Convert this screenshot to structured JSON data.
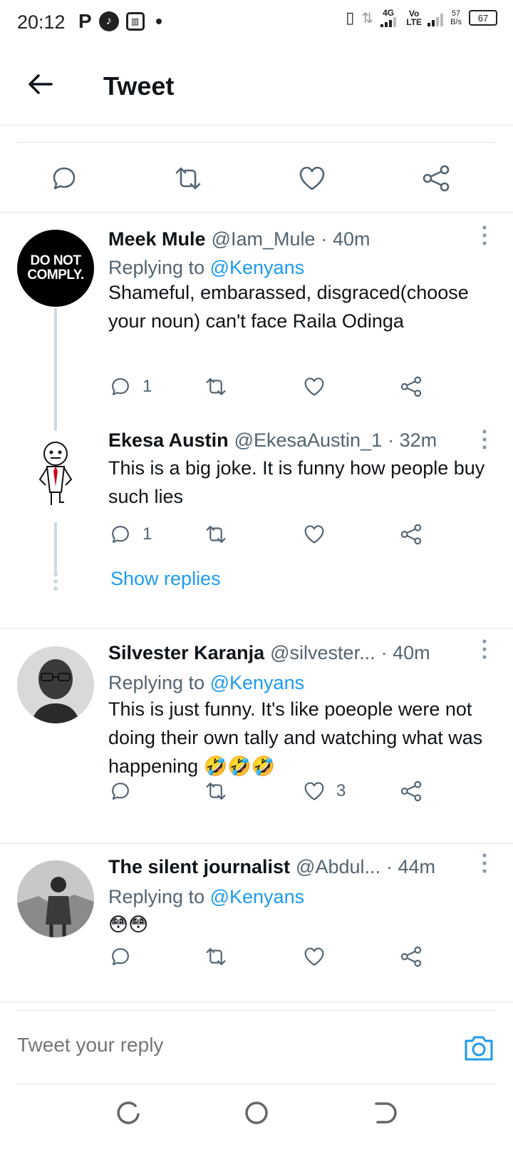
{
  "status_bar": {
    "time": "20:12",
    "left_icons": [
      "p-icon",
      "tiktok-icon",
      "notification-app-icon",
      "dot-icon"
    ],
    "network": "4G",
    "volte": "Vo LTE",
    "speed_value": "57",
    "speed_unit": "B/s",
    "battery": "67"
  },
  "header": {
    "back_icon": "arrow-left-icon",
    "title": "Tweet"
  },
  "main_tweet_actions": [
    "reply-icon",
    "retweet-icon",
    "like-icon",
    "share-icon"
  ],
  "replies": [
    {
      "name": "Meek Mule",
      "handle": "@Iam_Mule",
      "time": "· 40m",
      "replying_prefix": "Replying to",
      "replying_to": "@Kenyans",
      "avatar_text_1": "DO NOT",
      "avatar_text_2": "COMPLY.",
      "text": "Shameful, embarassed, disgraced(choose your noun) can't face Raila Odinga",
      "reply_count": "1",
      "retweet_count": "",
      "like_count": ""
    },
    {
      "name": "Ekesa Austin",
      "handle": "@EkesaAustin_1",
      "time": "· 32m",
      "text": "This is a big joke. It is funny how people buy such lies",
      "reply_count": "1",
      "retweet_count": "",
      "like_count": "",
      "show_replies": "Show replies"
    },
    {
      "name": "Silvester Karanja",
      "handle": "@silvester...",
      "time": "· 40m",
      "replying_prefix": "Replying to",
      "replying_to": "@Kenyans",
      "text": "This is just funny. It's like poeople were not doing their own tally and watching what was happening",
      "emojis": "🤣🤣🤣",
      "reply_count": "",
      "retweet_count": "",
      "like_count": "3"
    },
    {
      "name": "The silent journalist",
      "handle": "@Abdul...",
      "time": "· 44m",
      "replying_prefix": "Replying to",
      "replying_to": "@Kenyans",
      "emojis": "😳😳",
      "reply_count": "",
      "retweet_count": "",
      "like_count": ""
    }
  ],
  "composer": {
    "placeholder": "Tweet your reply",
    "camera_icon": "camera-icon"
  },
  "nav_bar": [
    "recents-icon",
    "home-icon",
    "back-icon"
  ],
  "colors": {
    "accent": "#1d9bf0",
    "text": "#0f1419",
    "secondary": "#536471",
    "divider": "#e6e6e6"
  }
}
